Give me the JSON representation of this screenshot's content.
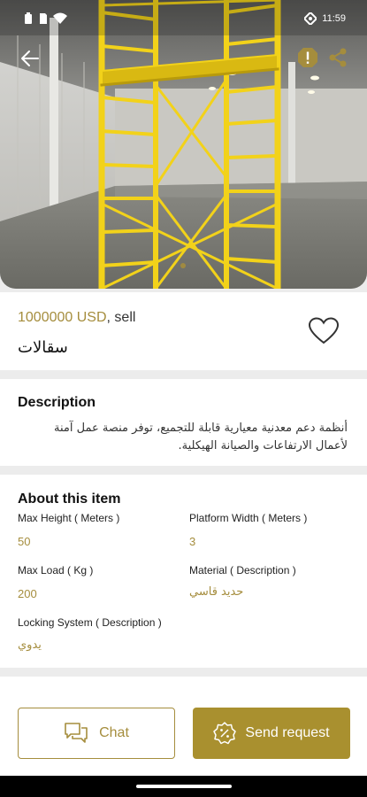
{
  "status_bar": {
    "time": "11:59"
  },
  "colors": {
    "accent": "#a9902f",
    "scaffold": "#f2d21a",
    "card": "#ffffff",
    "divider": "#ececec"
  },
  "icons": {
    "back": "arrow-left-icon",
    "report": "warning-icon",
    "share": "share-icon",
    "favorite": "heart-outline-icon",
    "chat": "chat-icon",
    "request": "percent-badge-icon"
  },
  "listing": {
    "price": "1000000 USD",
    "separator": ",",
    "deal_type": "sell",
    "title": "سقالات"
  },
  "description": {
    "heading": "Description",
    "text": "أنظمة دعم معدنية معيارية قابلة للتجميع، توفر منصة عمل آمنة لأعمال الارتفاعات والصيانة الهيكلية."
  },
  "about": {
    "heading": "About this item",
    "attributes": [
      {
        "label": "Max Height ( Meters )",
        "value": "50"
      },
      {
        "label": "Platform Width ( Meters )",
        "value": "3"
      },
      {
        "label": "Max Load (    Kg )",
        "value": "200"
      },
      {
        "label": "Material ( Description )",
        "value": "حديد قاسي"
      },
      {
        "label": "Locking System ( Description )",
        "value": "يدوي"
      }
    ]
  },
  "actions": {
    "chat_label": "Chat",
    "request_label": "Send request"
  }
}
